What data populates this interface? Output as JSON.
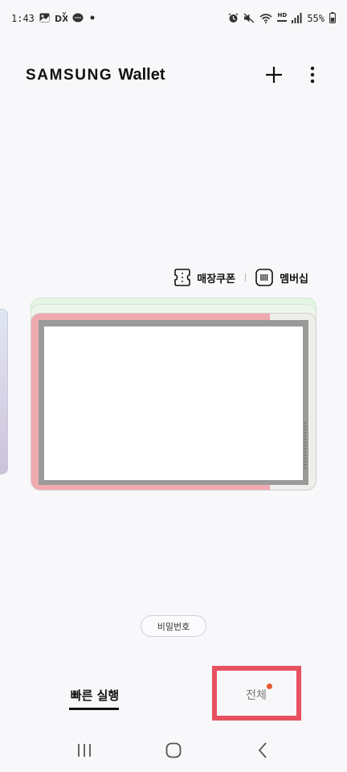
{
  "status_bar": {
    "time": "1:43",
    "battery": "55%",
    "network_badge": "HD",
    "left_icons": [
      "gallery-icon",
      "dx-app-icon",
      "chat-icon",
      "dot-icon"
    ],
    "right_icons": [
      "alarm-icon",
      "mute-icon",
      "wifi-icon",
      "hd-voice-icon",
      "signal-icon",
      "battery-icon"
    ]
  },
  "header": {
    "brand": "SAMSUNG",
    "product": "Wallet",
    "add_icon": "plus-icon",
    "more_icon": "more-vertical-icon"
  },
  "quick_links": [
    {
      "label": "매장쿠폰",
      "icon": "coupon-icon"
    },
    {
      "label": "멤버십",
      "icon": "barcode-card-icon"
    }
  ],
  "password_button": {
    "label": "비밀번호"
  },
  "tabs": [
    {
      "label": "빠른 실행",
      "selected": true
    },
    {
      "label": "전체",
      "selected": false,
      "has_badge": true
    }
  ],
  "colors": {
    "highlight": "#e8515f",
    "badge": "#e6572d",
    "card_pink": "#f1a9b0",
    "card_green": "#e4f5e4"
  },
  "nav_bar": {
    "recents_icon": "recents-icon",
    "home_icon": "home-icon",
    "back_icon": "back-icon"
  }
}
